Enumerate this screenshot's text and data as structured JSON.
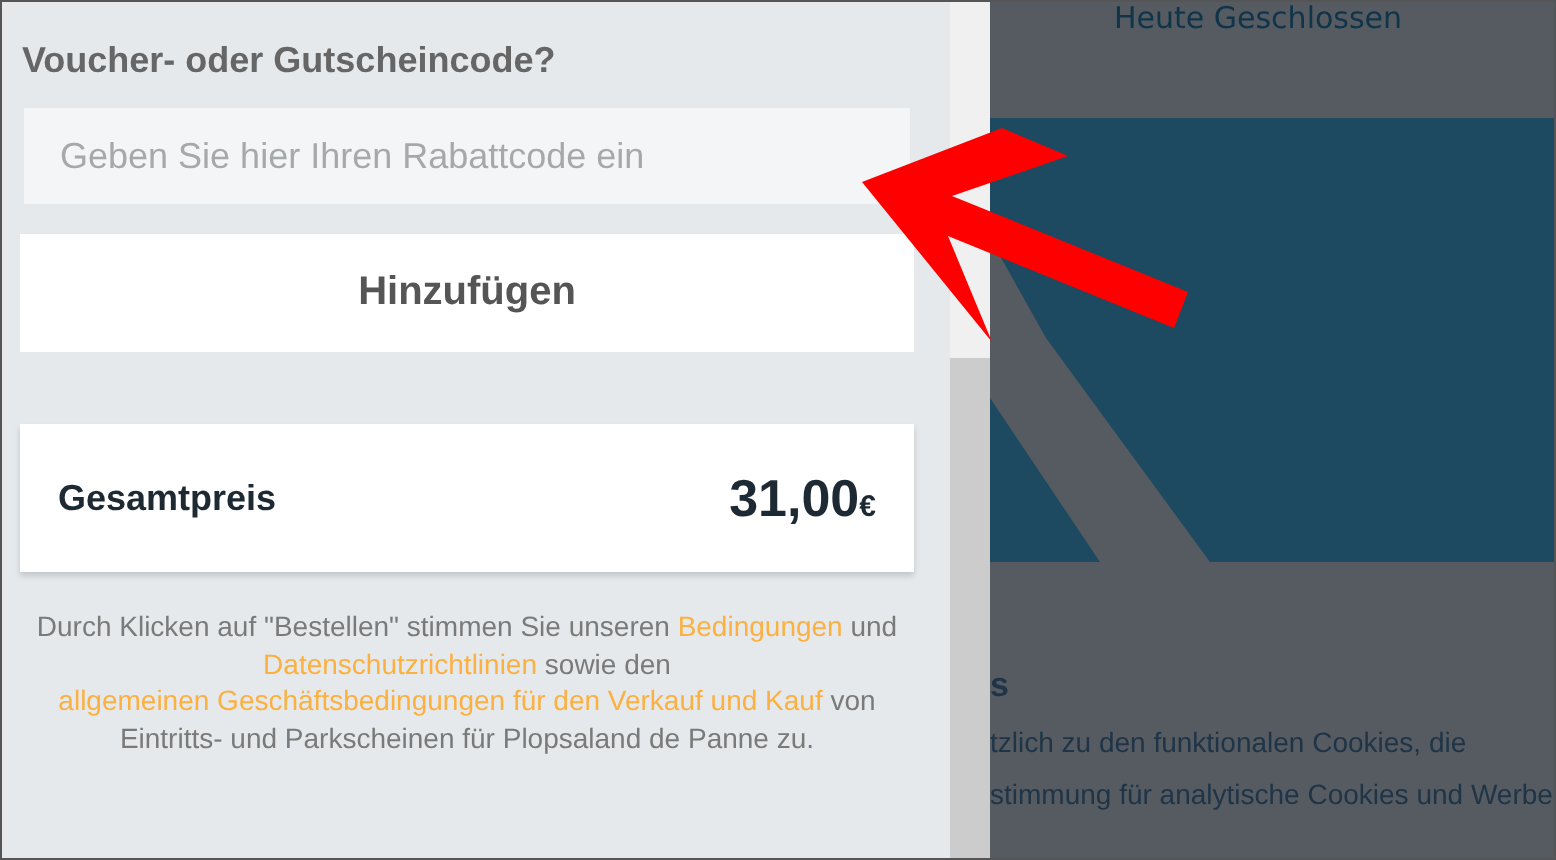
{
  "voucher": {
    "heading": "Voucher- oder Gutscheincode?",
    "input": {
      "placeholder": "Geben Sie hier Ihren Rabattcode ein"
    },
    "button": "Hinzufügen"
  },
  "total": {
    "label": "Gesamtpreis",
    "amount": "31,00",
    "currency": "€"
  },
  "legal": [
    {
      "kind": "text",
      "text": "Durch Klicken auf \"Bestellen\" stimmen Sie unseren "
    },
    {
      "kind": "link",
      "text": "Bedingungen"
    },
    {
      "kind": "text",
      "text": " und "
    },
    {
      "kind": "link",
      "text": "Datenschutzrichtlinien"
    },
    {
      "kind": "text",
      "text": " sowie den "
    },
    {
      "kind": "link",
      "text": "allgemeinen Geschäftsbedingungen für den Verkauf und Kauf"
    },
    {
      "kind": "text",
      "text": " von Eintritts- und Parkscheinen für Plopsaland de Panne zu."
    }
  ],
  "background_page": {
    "status": "Heute Geschlossen",
    "heading_fragment": "s",
    "body_lines": [
      "tzlich zu den funktionalen Cookies, die",
      "stimmung für analytische Cookies und Werbe"
    ]
  }
}
